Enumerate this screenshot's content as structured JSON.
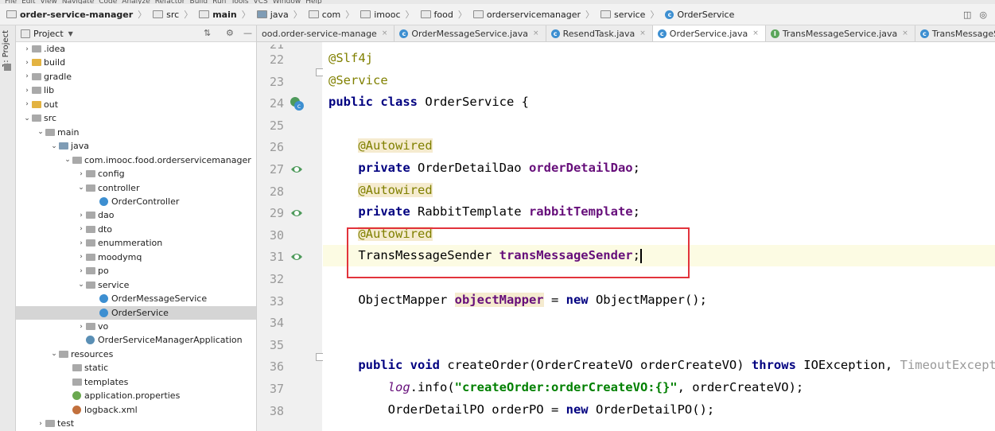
{
  "menubar": {
    "items": [
      "File",
      "Edit",
      "View",
      "Navigate",
      "Code",
      "Analyze",
      "Refactor",
      "Build",
      "Run",
      "Tools",
      "VCS",
      "Window",
      "Help"
    ]
  },
  "breadcrumb": {
    "project": "order-service-manager",
    "parts": [
      "src",
      "main",
      "java",
      "com",
      "imooc",
      "food",
      "orderservicemanager",
      "service",
      "OrderService"
    ]
  },
  "left_strip": {
    "label": "1: Project"
  },
  "panel": {
    "title": "Project"
  },
  "tree": [
    {
      "label": ".idea",
      "indent": 0,
      "arrow": "›",
      "icon": "folder-gray"
    },
    {
      "label": "build",
      "indent": 0,
      "arrow": "›",
      "icon": "folder-yellow"
    },
    {
      "label": "gradle",
      "indent": 0,
      "arrow": "›",
      "icon": "folder-gray"
    },
    {
      "label": "lib",
      "indent": 0,
      "arrow": "›",
      "icon": "folder-gray"
    },
    {
      "label": "out",
      "indent": 0,
      "arrow": "›",
      "icon": "folder-yellow"
    },
    {
      "label": "src",
      "indent": 0,
      "arrow": "⌄",
      "icon": "folder-gray"
    },
    {
      "label": "main",
      "indent": 1,
      "arrow": "⌄",
      "icon": "folder-gray"
    },
    {
      "label": "java",
      "indent": 2,
      "arrow": "⌄",
      "icon": "folder-blue"
    },
    {
      "label": "com.imooc.food.orderservicemanager",
      "indent": 3,
      "arrow": "⌄",
      "icon": "folder-gray"
    },
    {
      "label": "config",
      "indent": 4,
      "arrow": "›",
      "icon": "folder-gray"
    },
    {
      "label": "controller",
      "indent": 4,
      "arrow": "⌄",
      "icon": "folder-gray"
    },
    {
      "label": "OrderController",
      "indent": 5,
      "arrow": "",
      "icon": "class"
    },
    {
      "label": "dao",
      "indent": 4,
      "arrow": "›",
      "icon": "folder-gray"
    },
    {
      "label": "dto",
      "indent": 4,
      "arrow": "›",
      "icon": "folder-gray"
    },
    {
      "label": "enummeration",
      "indent": 4,
      "arrow": "›",
      "icon": "folder-gray"
    },
    {
      "label": "moodymq",
      "indent": 4,
      "arrow": "›",
      "icon": "folder-gray"
    },
    {
      "label": "po",
      "indent": 4,
      "arrow": "›",
      "icon": "folder-gray"
    },
    {
      "label": "service",
      "indent": 4,
      "arrow": "⌄",
      "icon": "folder-gray"
    },
    {
      "label": "OrderMessageService",
      "indent": 5,
      "arrow": "",
      "icon": "class"
    },
    {
      "label": "OrderService",
      "indent": 5,
      "arrow": "",
      "icon": "class",
      "selected": true
    },
    {
      "label": "vo",
      "indent": 4,
      "arrow": "›",
      "icon": "folder-gray"
    },
    {
      "label": "OrderServiceManagerApplication",
      "indent": 4,
      "arrow": "",
      "icon": "spring-class"
    },
    {
      "label": "resources",
      "indent": 2,
      "arrow": "⌄",
      "icon": "folder-gray"
    },
    {
      "label": "static",
      "indent": 3,
      "arrow": "",
      "icon": "folder-gray"
    },
    {
      "label": "templates",
      "indent": 3,
      "arrow": "",
      "icon": "folder-gray"
    },
    {
      "label": "application.properties",
      "indent": 3,
      "arrow": "",
      "icon": "properties"
    },
    {
      "label": "logback.xml",
      "indent": 3,
      "arrow": "",
      "icon": "xml"
    },
    {
      "label": "test",
      "indent": 1,
      "arrow": "›",
      "icon": "folder-gray"
    }
  ],
  "tabs": [
    {
      "label": "ood.order-service-manage",
      "icon": "gradle"
    },
    {
      "label": "OrderMessageService.java",
      "icon": "class"
    },
    {
      "label": "ResendTask.java",
      "icon": "class"
    },
    {
      "label": "OrderService.java",
      "icon": "class",
      "active": true
    },
    {
      "label": "TransMessageService.java",
      "icon": "interface"
    },
    {
      "label": "TransMessageServiceImpl.java",
      "icon": "class"
    }
  ],
  "code": {
    "line_numbers": [
      "22",
      "23",
      "24",
      "25",
      "26",
      "27",
      "28",
      "29",
      "30",
      "31",
      "32",
      "33",
      "34",
      "35",
      "36",
      "37",
      "38"
    ],
    "top_partial_number": "21",
    "lines": [
      [
        "@Slf4j"
      ],
      [
        "@Service"
      ],
      [
        "public class ",
        "OrderService {"
      ],
      [
        ""
      ],
      [
        "@Autowired"
      ],
      [
        "private ",
        "OrderDetailDao ",
        "orderDetailDao",
        ";"
      ],
      [
        "@Autowired"
      ],
      [
        "private ",
        "RabbitTemplate ",
        "rabbitTemplate",
        ";"
      ],
      [
        "@Autowired"
      ],
      [
        "TransMessageSender ",
        "transMessageSender",
        ";"
      ],
      [
        ""
      ],
      [
        "ObjectMapper ",
        "objectMapper",
        " = ",
        "new ",
        "ObjectMapper();"
      ],
      [
        ""
      ],
      [
        ""
      ],
      [
        "public void ",
        "createOrder(OrderCreateVO orderCreateVO) ",
        "throws ",
        "IOException, ",
        "TimeoutExceptio"
      ],
      [
        "log",
        ".info(",
        "\"createOrder:orderCreateVO:{}\"",
        ", orderCreateVO);"
      ],
      [
        "OrderDetailPO orderPO = ",
        "new ",
        "OrderDetailPO();"
      ]
    ]
  }
}
